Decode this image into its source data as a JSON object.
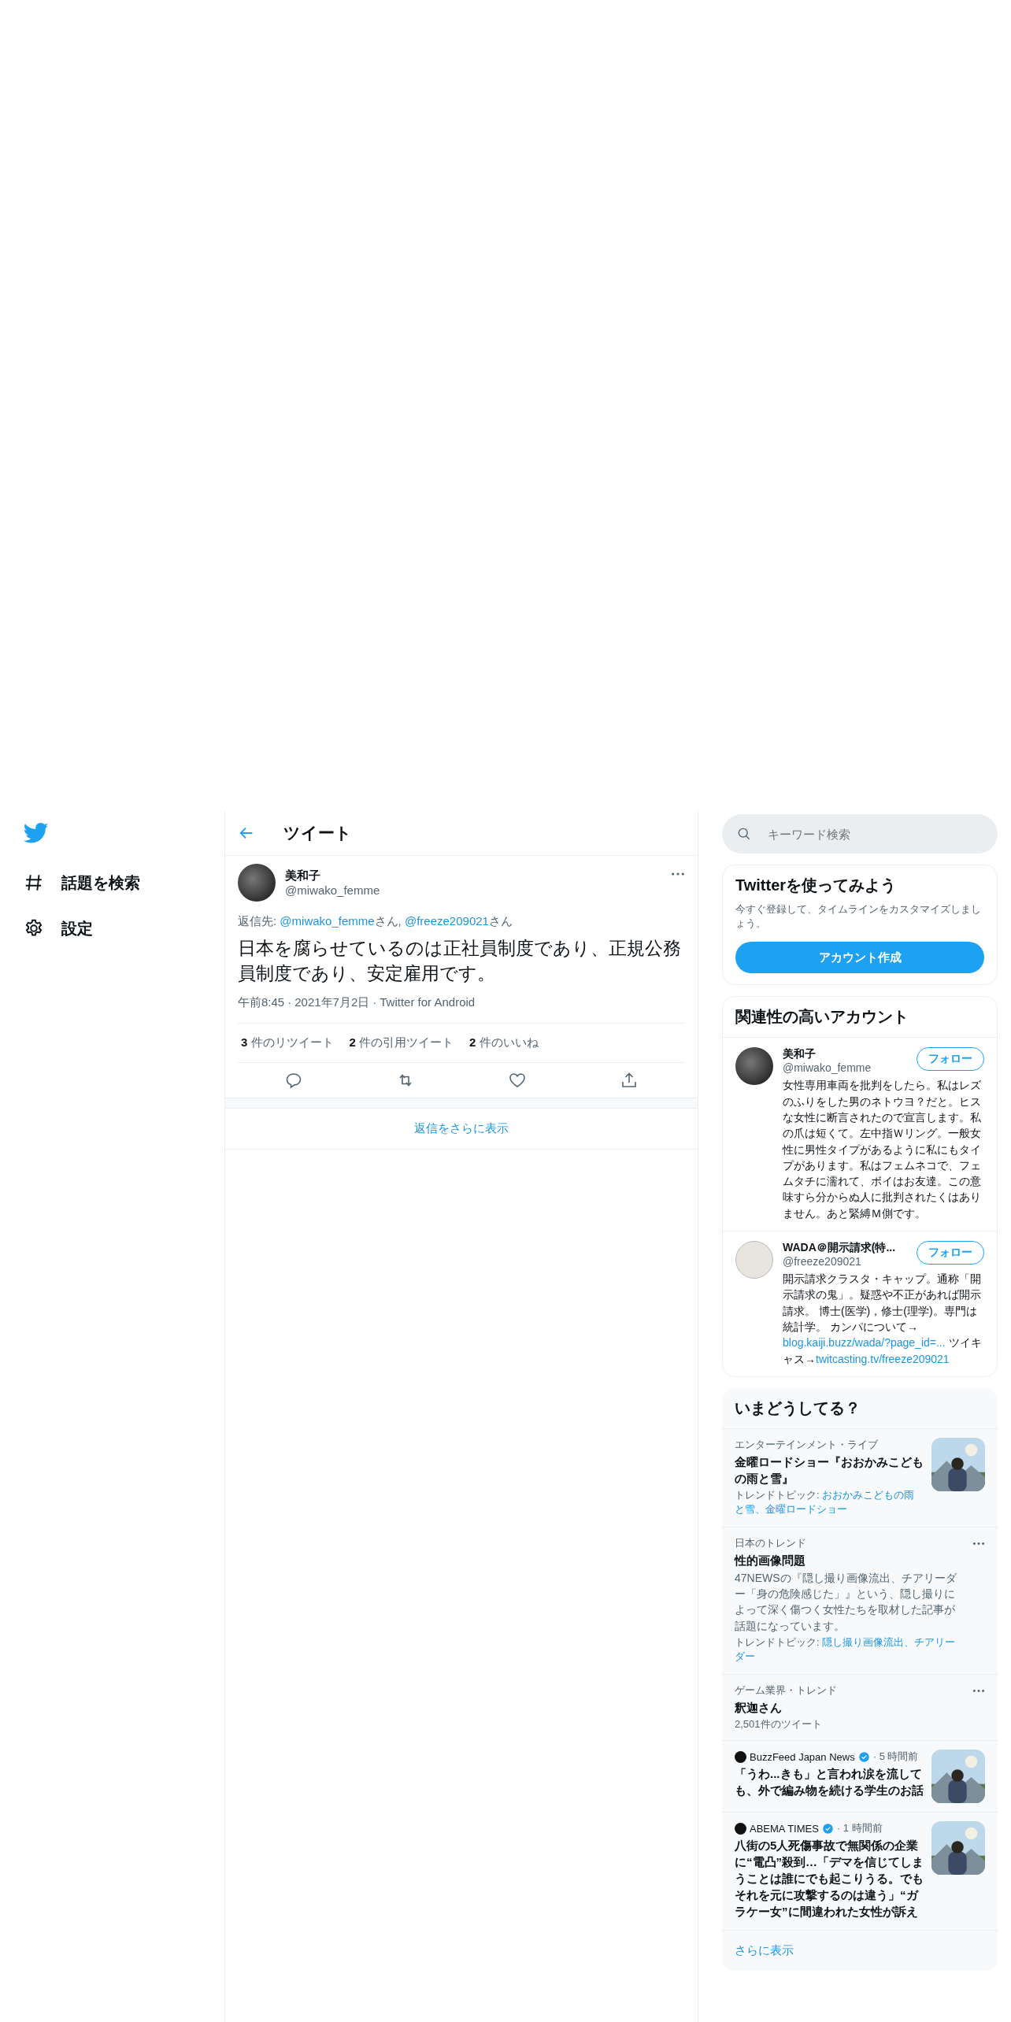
{
  "nav": {
    "items": [
      {
        "kind": "hash",
        "label": "話題を検索"
      },
      {
        "kind": "gear",
        "label": "設定"
      }
    ]
  },
  "header": {
    "title": "ツイート"
  },
  "tweet": {
    "name": "美和子",
    "handle": "@miwako_femme",
    "reply_to": [
      {
        "kind": "plain",
        "text": "返信先: "
      },
      {
        "kind": "link",
        "text": "@miwako_femme"
      },
      {
        "kind": "plain",
        "text": "さん, "
      },
      {
        "kind": "link",
        "text": "@freeze209021"
      },
      {
        "kind": "plain",
        "text": "さん"
      }
    ],
    "text": "日本を腐らせているのは正社員制度であり、正規公務員制度であり、安定雇用です。",
    "time": "午前8:45",
    "separator": "·",
    "date": "2021年7月2日",
    "source": "Twitter for Android",
    "stats": [
      {
        "count": "3",
        "label": "件のリツイート"
      },
      {
        "count": "2",
        "label": "件の引用ツイート"
      },
      {
        "count": "2",
        "label": "件のいいね"
      }
    ],
    "actions": [
      {
        "kind": "reply"
      },
      {
        "kind": "retweet"
      },
      {
        "kind": "like"
      },
      {
        "kind": "share"
      }
    ],
    "more_replies": "返信をさらに表示"
  },
  "search": {
    "placeholder": "キーワード検索"
  },
  "signup": {
    "title": "Twitterを使ってみよう",
    "text": "今すぐ登録して、タイムラインをカスタマイズしましょう。",
    "button": "アカウント作成"
  },
  "accounts": {
    "title": "関連性の高いアカウント",
    "items": [
      {
        "name": "美和子",
        "handle": "@miwako_femme",
        "button": "フォロー",
        "bio": [
          {
            "kind": "plain",
            "text": "女性専用車両を批判をしたら。私はレズのふりをした男のネトウヨ？だと。ヒスな女性に断言されたので宣言します。私の爪は短くて。左中指Ｗリング。一般女性に男性タイプがあるように私にもタイプがあります。私はフェムネコで、フェムタチに濡れて、ボイはお友達。この意味すら分からぬ人に批判されたくはありません。あと緊縛Ｍ側です。"
          }
        ]
      },
      {
        "name": "WADA＠開示請求(特...",
        "handle": "@freeze209021",
        "button": "フォロー",
        "bio": [
          {
            "kind": "plain",
            "text": "開示請求クラスタ・キャップ。通称「開示請求の鬼」。疑惑や不正があれば開示請求。 博士(医学)，修士(理学)。専門は統計学。 カンパについて→"
          },
          {
            "kind": "link",
            "text": "blog.kaiji.buzz/wada/?page_id=..."
          },
          {
            "kind": "plain",
            "text": " ツイキャス→"
          },
          {
            "kind": "link",
            "text": "twitcasting.tv/freeze209021"
          }
        ]
      }
    ]
  },
  "trends": {
    "title": "いまどうしてる？",
    "items": [
      {
        "kind": "trend",
        "category": "エンターテインメント・ライブ",
        "title": "金曜ロードショー『おおかみこどもの雨と雪』",
        "topic_label": "トレンドトピック: ",
        "topic": "おおかみこどもの雨と雪、金曜ロードショー",
        "thumbnail": true,
        "menu": false
      },
      {
        "kind": "trend",
        "category": "日本のトレンド",
        "title": "性的画像問題",
        "description": "47NEWSの『隠し撮り画像流出、チアリーダー「身の危険感じた」』という、隠し撮りによって深く傷つく女性たちを取材した記事が話題になっています。",
        "topic_label": "トレンドトピック: ",
        "topic": "隠し撮り画像流出、チアリーダー",
        "menu": true
      },
      {
        "kind": "trend",
        "category": "ゲーム業界・トレンド",
        "title": "釈迦さん",
        "count": "2,501件のツイート",
        "menu": true
      },
      {
        "kind": "news",
        "source": "BuzzFeed Japan News",
        "verified": true,
        "time": "· 5 時間前",
        "title": "「うわ...きも」と言われ涙を流しても、外で編み物を続ける学生のお話",
        "thumbnail": true
      },
      {
        "kind": "news",
        "source": "ABEMA TIMES",
        "verified": true,
        "time": "· 1 時間前",
        "title": "八街の5人死傷事故で無関係の企業に“電凸”殺到…「デマを信じてしまうことは誰にでも起こりうる。でもそれを元に攻撃するのは違う」“ガラケー女”に間違われた女性が訴え",
        "thumbnail": true
      }
    ],
    "more": "さらに表示"
  }
}
